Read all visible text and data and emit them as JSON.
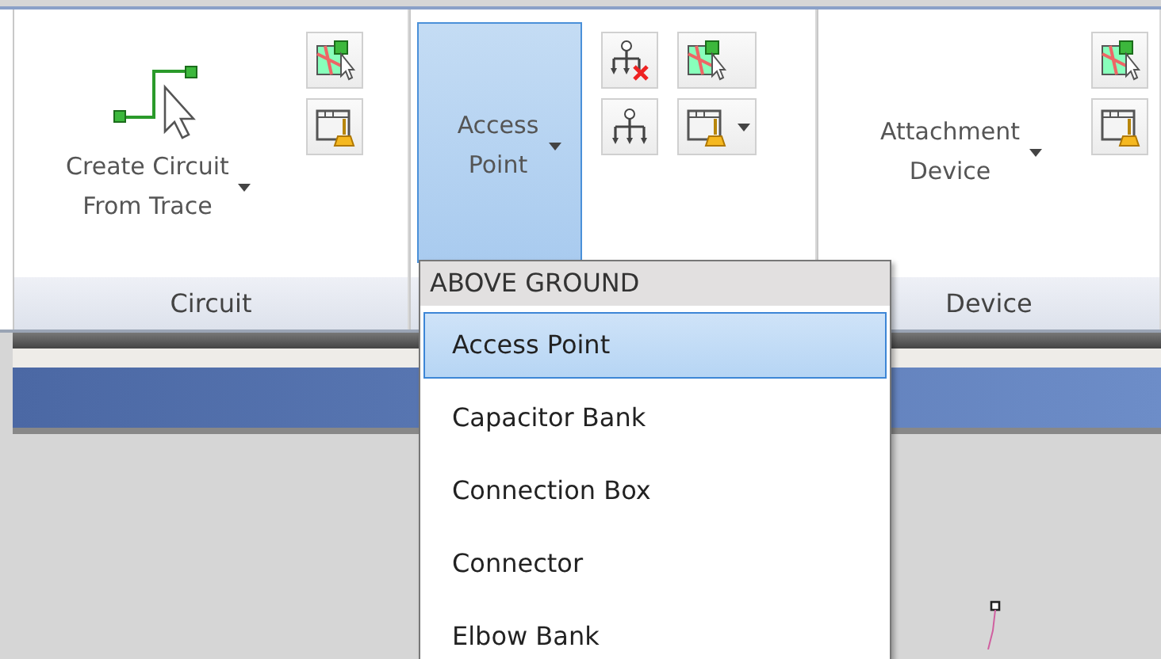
{
  "ribbon": {
    "panels": [
      {
        "label": "Circuit",
        "large_button": {
          "kind": "trace",
          "label_lines": [
            "Create Circuit",
            "From Trace"
          ],
          "dropdown": true,
          "selected": false
        },
        "small_columns": [
          [
            {
              "kind": "map-select",
              "dropdown": false
            },
            {
              "kind": "window-brush",
              "dropdown": false
            }
          ]
        ]
      },
      {
        "large_button": {
          "kind": "none",
          "label_lines": [
            "Access",
            "Point"
          ],
          "dropdown": true,
          "selected": true
        },
        "small_columns": [
          [
            {
              "kind": "tree-delete",
              "dropdown": false
            },
            {
              "kind": "tree",
              "dropdown": false
            }
          ],
          [
            {
              "kind": "map-select",
              "dropdown": false
            },
            {
              "kind": "window-brush",
              "dropdown": true
            }
          ]
        ]
      },
      {
        "label": "Device",
        "large_button": {
          "kind": "none",
          "label_lines": [
            "Attachment",
            "Device"
          ],
          "dropdown": true,
          "selected": false
        },
        "small_columns": [
          [
            {
              "kind": "map-select",
              "dropdown": false
            },
            {
              "kind": "window-brush",
              "dropdown": false
            }
          ]
        ]
      }
    ]
  },
  "dropdown_menu": {
    "header": "ABOVE GROUND",
    "items": [
      {
        "label": "Access Point",
        "selected": true
      },
      {
        "label": "Capacitor Bank",
        "selected": false
      },
      {
        "label": "Connection Box",
        "selected": false
      },
      {
        "label": "Connector",
        "selected": false
      },
      {
        "label": "Elbow Bank",
        "selected": false
      }
    ]
  }
}
